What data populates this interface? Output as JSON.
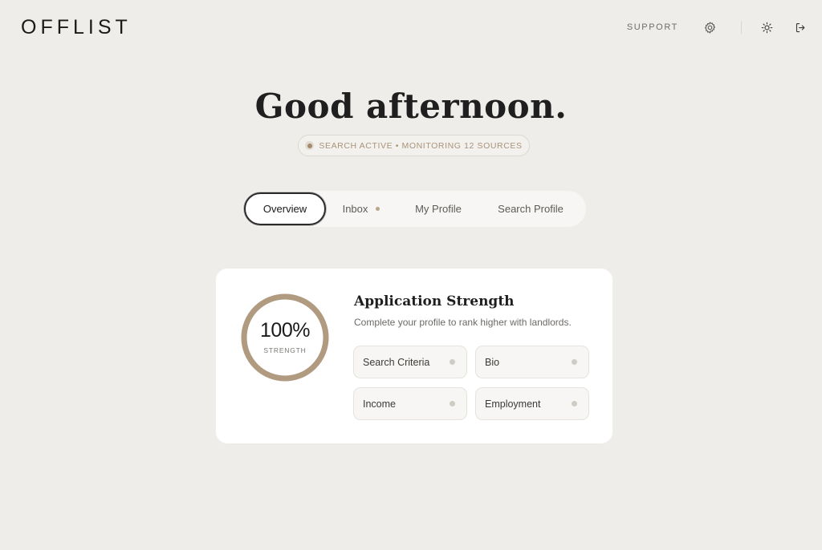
{
  "brand": {
    "logo": "OFFLIST"
  },
  "header": {
    "support_label": "SUPPORT",
    "icons": [
      "gear-icon",
      "sun-icon",
      "logout-icon"
    ]
  },
  "greeting": "Good afternoon.",
  "status": {
    "text": "SEARCH ACTIVE • MONITORING 12 SOURCES"
  },
  "tabs": [
    {
      "label": "Overview",
      "active": true
    },
    {
      "label": "Inbox",
      "has_unread": true
    },
    {
      "label": "My Profile"
    },
    {
      "label": "Search Profile"
    }
  ],
  "strength_card": {
    "value": "100%",
    "value_fraction": 1.0,
    "value_label": "STRENGTH",
    "title": "Application Strength",
    "subtitle": "Complete your profile to rank higher with landlords.",
    "items": [
      {
        "label": "Search Criteria"
      },
      {
        "label": "Bio"
      },
      {
        "label": "Income"
      },
      {
        "label": "Employment"
      }
    ]
  },
  "colors": {
    "background": "#efede9",
    "accent": "#b09a80",
    "card": "#ffffff",
    "text": "#1f1f1f"
  }
}
